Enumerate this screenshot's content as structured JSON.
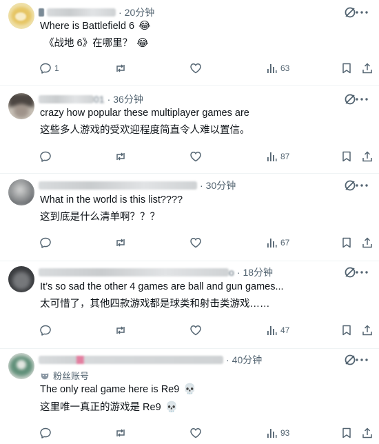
{
  "replies": [
    {
      "time": "20分钟",
      "text_en": "Where is Battlefield 6",
      "emoji_en": "😂",
      "text_zh": "《战地 6》在哪里？",
      "emoji_zh": "😂",
      "reply_count": "1",
      "view_count": "63"
    },
    {
      "name_tail": "01",
      "time": "36分钟",
      "text_en": "crazy how popular these multiplayer games are",
      "text_zh": "这些多人游戏的受欢迎程度简直令人难以置信。",
      "reply_count": "",
      "view_count": "87"
    },
    {
      "time": "30分钟",
      "text_en": "What in the world is this list????",
      "text_zh": "这到底是什么清单啊？？？",
      "reply_count": "",
      "view_count": "67"
    },
    {
      "name_tail": "o",
      "time": "18分钟",
      "text_en": "It’s so sad the other 4 games are ball and gun games...",
      "text_zh": "太可惜了，其他四款游戏都是球类和射击类游戏……",
      "reply_count": "",
      "view_count": "47"
    },
    {
      "time": "40分钟",
      "fan_label": "粉丝账号",
      "text_en": "The only real game here is Re9",
      "emoji_en": "💀",
      "text_zh": "这里唯一真正的游戏是 Re9",
      "emoji_zh": "💀",
      "reply_count": "",
      "view_count": "93"
    }
  ],
  "icons": {
    "reply": "reply-icon",
    "repost": "repost-icon",
    "like": "heart-icon",
    "views": "views-icon",
    "bookmark": "bookmark-icon",
    "share": "share-icon",
    "grok": "grok-icon"
  },
  "colors": {
    "text": "#0f1419",
    "muted": "#536471",
    "divider": "#eff3f4"
  }
}
